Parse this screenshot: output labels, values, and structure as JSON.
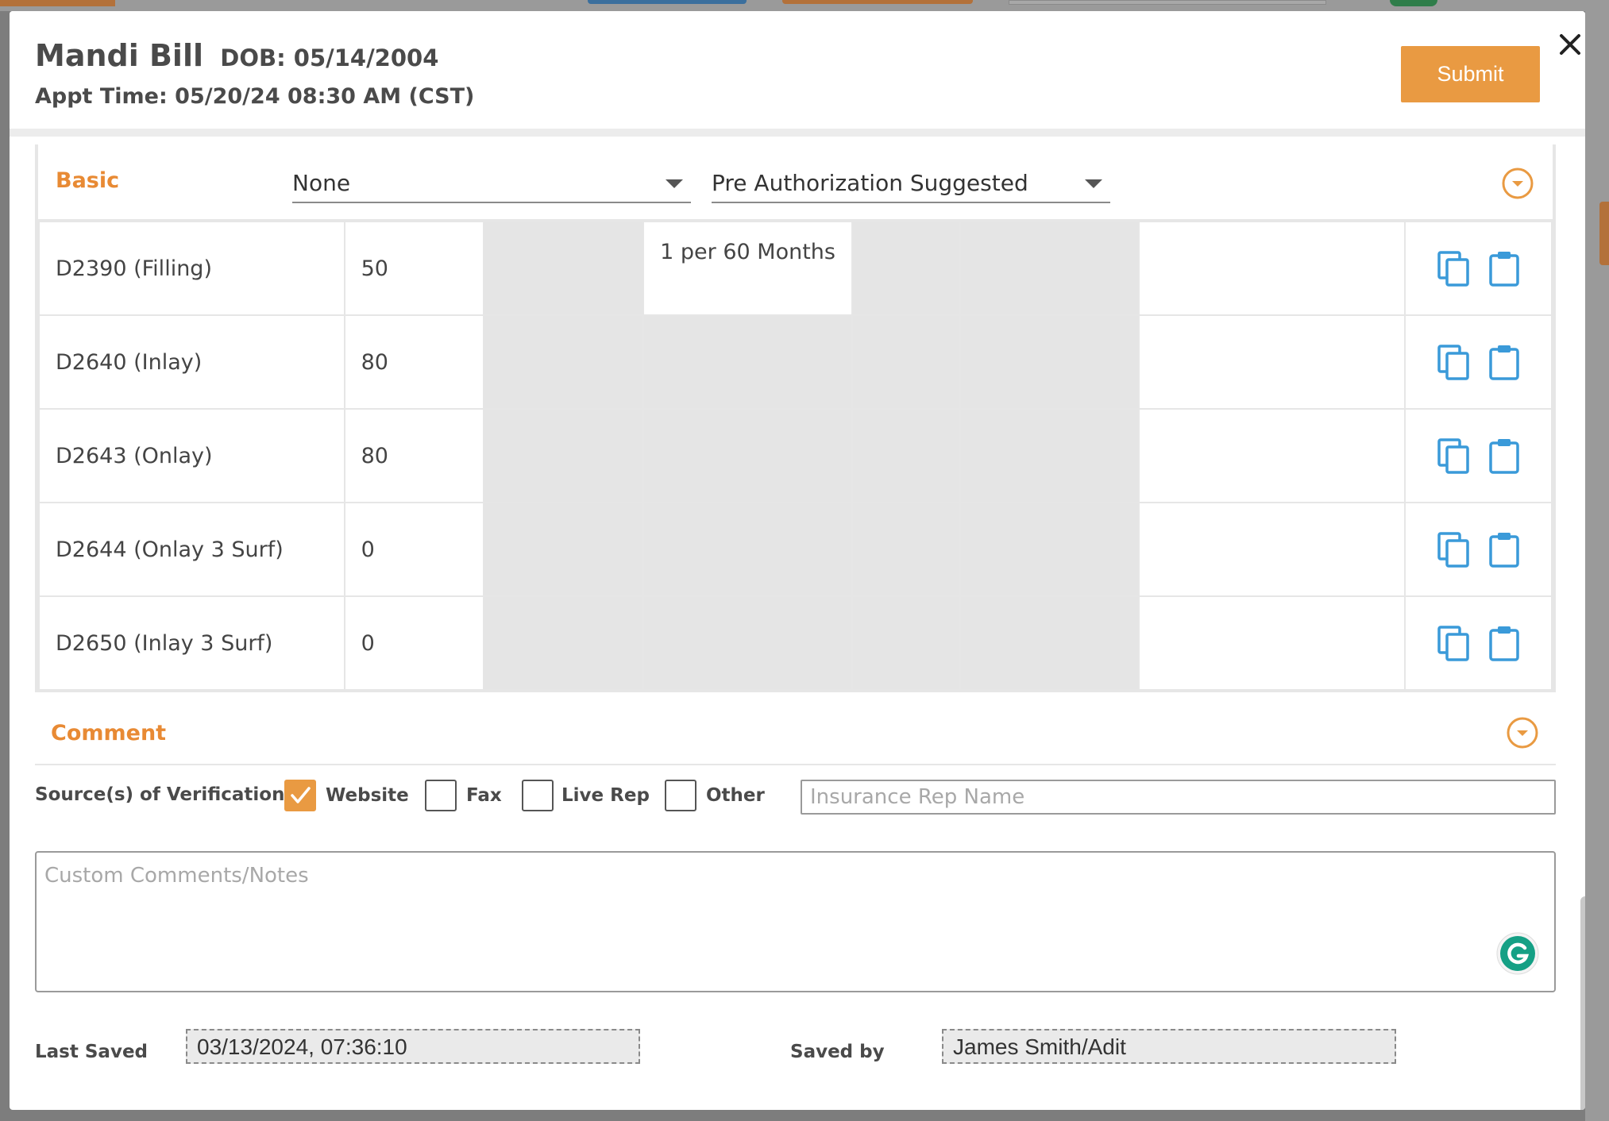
{
  "header": {
    "patient_name": "Mandi Bill",
    "dob": "DOB: 05/14/2004",
    "appt_time": "Appt Time: 05/20/24 08:30 AM (CST)",
    "submit_label": "Submit",
    "close_icon": "close-icon"
  },
  "basic": {
    "title": "Basic",
    "select_1": "None",
    "select_2": "Pre Authorization Suggested",
    "rows": [
      {
        "code": "D2390 (Filling)",
        "value": "50",
        "frequency": "1 per 60 Months"
      },
      {
        "code": "D2640 (Inlay)",
        "value": "80",
        "frequency": ""
      },
      {
        "code": "D2643 (Onlay)",
        "value": "80",
        "frequency": ""
      },
      {
        "code": "D2644 (Onlay 3 Surf)",
        "value": "0",
        "frequency": ""
      },
      {
        "code": "D2650 (Inlay 3 Surf)",
        "value": "0",
        "frequency": ""
      }
    ],
    "row_icons": [
      "copy-icon",
      "clipboard-icon"
    ]
  },
  "comment": {
    "title": "Comment",
    "sources_label": "Source(s) of Verification",
    "options": [
      {
        "label": "Website",
        "checked": true
      },
      {
        "label": "Fax",
        "checked": false
      },
      {
        "label": "Live Rep",
        "checked": false
      },
      {
        "label": "Other",
        "checked": false
      }
    ],
    "rep_placeholder": "Insurance Rep Name",
    "notes_placeholder": "Custom Comments/Notes"
  },
  "footer": {
    "last_saved_label": "Last Saved",
    "last_saved_value": "03/13/2024, 07:36:10",
    "saved_by_label": "Saved by",
    "saved_by_value": "James Smith/Adit"
  },
  "colors": {
    "accent": "#e99a42",
    "section_title": "#e88a34",
    "icon_blue": "#3a9ad9"
  }
}
